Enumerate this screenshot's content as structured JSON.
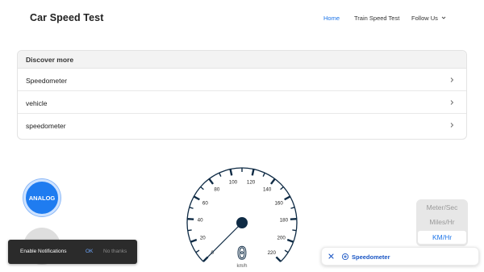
{
  "header": {
    "title": "Car Speed Test",
    "nav": {
      "home": "Home",
      "train": "Train Speed Test",
      "follow": "Follow Us"
    }
  },
  "discover": {
    "heading": "Discover more",
    "items": [
      {
        "label": "Speedometer"
      },
      {
        "label": "vehicle"
      },
      {
        "label": "speedometer"
      }
    ]
  },
  "modes": {
    "analog": "ANALOG"
  },
  "speedometer": {
    "digital_value": "0",
    "unit": "km/h",
    "tick_labels": [
      "0",
      "20",
      "40",
      "60",
      "80",
      "100",
      "120",
      "140",
      "160",
      "180",
      "200",
      "220"
    ],
    "needle_speed": 0,
    "max_speed": 220,
    "color_dial": "#0f2b45"
  },
  "units": {
    "meter_sec": "Meter/Sec",
    "miles_hr": "Miles/Hr",
    "km_hr": "KM/Hr",
    "selected": "KM/Hr"
  },
  "notification": {
    "text": "Enable Notifications",
    "ok": "OK",
    "no": "No thanks"
  },
  "chip": {
    "label": "Speedometer"
  },
  "colors": {
    "accent": "#1a73e8",
    "analog_button": "#1f7cf0"
  }
}
